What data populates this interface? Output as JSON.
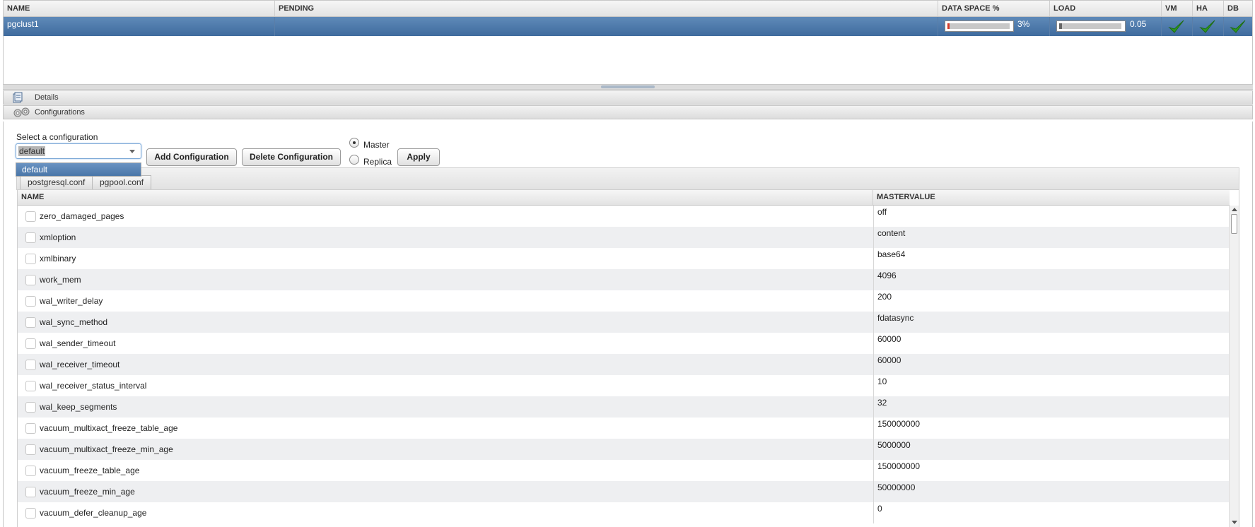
{
  "cluster_grid": {
    "columns": [
      "NAME",
      "PENDING",
      "DATA SPACE %",
      "LOAD",
      "VM",
      "HA",
      "DB"
    ],
    "row": {
      "name": "pgclust1",
      "pending": "",
      "data_space_label": "3%",
      "data_space_fraction": 0.03,
      "load_label": "0.05",
      "load_fraction": 0.05,
      "vm_status": "check-icon",
      "ha_status": "check-icon",
      "db_status": "check-icon"
    }
  },
  "accordion": {
    "details_label": "Details",
    "configurations_label": "Configurations"
  },
  "config": {
    "select_label": "Select a configuration",
    "selected_value": "default",
    "dropdown_options": [
      "default"
    ],
    "add_button": "Add Configuration",
    "delete_button": "Delete Configuration",
    "radio_master": "Master",
    "radio_replica": "Replica",
    "radio_selected": "Master",
    "apply_button": "Apply"
  },
  "file_tabs": [
    "postgresql.conf",
    "pgpool.conf"
  ],
  "param_grid": {
    "columns": [
      "NAME",
      "MASTERVALUE"
    ],
    "rows": [
      {
        "name": "zero_damaged_pages",
        "value": "off"
      },
      {
        "name": "xmloption",
        "value": "content"
      },
      {
        "name": "xmlbinary",
        "value": "base64"
      },
      {
        "name": "work_mem",
        "value": "4096"
      },
      {
        "name": "wal_writer_delay",
        "value": "200"
      },
      {
        "name": "wal_sync_method",
        "value": "fdatasync"
      },
      {
        "name": "wal_sender_timeout",
        "value": "60000"
      },
      {
        "name": "wal_receiver_timeout",
        "value": "60000"
      },
      {
        "name": "wal_receiver_status_interval",
        "value": "10"
      },
      {
        "name": "wal_keep_segments",
        "value": "32"
      },
      {
        "name": "vacuum_multixact_freeze_table_age",
        "value": "150000000"
      },
      {
        "name": "vacuum_multixact_freeze_min_age",
        "value": "5000000"
      },
      {
        "name": "vacuum_freeze_table_age",
        "value": "150000000"
      },
      {
        "name": "vacuum_freeze_min_age",
        "value": "50000000"
      },
      {
        "name": "vacuum_defer_cleanup_age",
        "value": "0"
      }
    ]
  },
  "colors": {
    "selected_row": "#4a76a8",
    "check_green": "#2e9a1e",
    "data_space_fill": "#d43a2a"
  }
}
